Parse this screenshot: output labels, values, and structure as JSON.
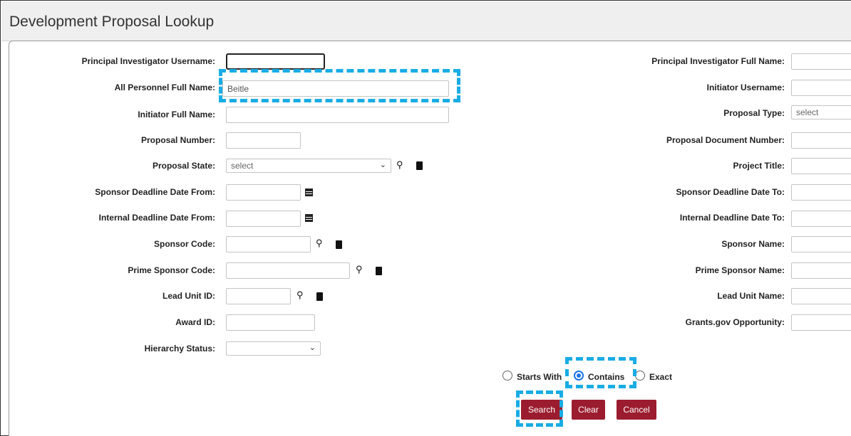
{
  "page": {
    "title": "Development Proposal Lookup"
  },
  "left_fields": {
    "pi_username": {
      "label": "Principal Investigator Username:",
      "value": ""
    },
    "all_personnel": {
      "label": "All Personnel Full Name:",
      "value": "Beitle"
    },
    "initiator_full_name": {
      "label": "Initiator Full Name:",
      "value": ""
    },
    "proposal_number": {
      "label": "Proposal Number:",
      "value": ""
    },
    "proposal_state": {
      "label": "Proposal State:",
      "value": "select"
    },
    "sponsor_deadline_from": {
      "label": "Sponsor Deadline Date From:",
      "value": ""
    },
    "internal_deadline_from": {
      "label": "Internal Deadline Date From:",
      "value": ""
    },
    "sponsor_code": {
      "label": "Sponsor Code:",
      "value": ""
    },
    "prime_sponsor_code": {
      "label": "Prime Sponsor Code:",
      "value": ""
    },
    "lead_unit_id": {
      "label": "Lead Unit ID:",
      "value": ""
    },
    "award_id": {
      "label": "Award ID:",
      "value": ""
    },
    "hierarchy_status": {
      "label": "Hierarchy Status:",
      "value": ""
    }
  },
  "right_fields": {
    "pi_full_name": {
      "label": "Principal Investigator Full Name:",
      "value": ""
    },
    "initiator_username": {
      "label": "Initiator Username:",
      "value": ""
    },
    "proposal_type": {
      "label": "Proposal Type:",
      "value": "select"
    },
    "proposal_document_number": {
      "label": "Proposal Document Number:",
      "value": ""
    },
    "project_title": {
      "label": "Project Title:",
      "value": ""
    },
    "sponsor_deadline_to": {
      "label": "Sponsor Deadline Date To:",
      "value": ""
    },
    "internal_deadline_to": {
      "label": "Internal Deadline Date To:",
      "value": ""
    },
    "sponsor_name": {
      "label": "Sponsor Name:",
      "value": ""
    },
    "prime_sponsor_name": {
      "label": "Prime Sponsor Name:",
      "value": ""
    },
    "lead_unit_name": {
      "label": "Lead Unit Name:",
      "value": ""
    },
    "grants_gov_opportunity": {
      "label": "Grants.gov Opportunity:",
      "value": ""
    }
  },
  "match_options": {
    "starts_with": "Starts With",
    "contains": "Contains",
    "exact": "Exact",
    "selected": "Contains"
  },
  "buttons": {
    "search": "Search",
    "clear": "Clear",
    "cancel": "Cancel"
  },
  "icons": {
    "lookup": "search-icon",
    "direct_inquiry": "book-icon",
    "date_picker": "calendar-icon",
    "dropdown": "chevron-down-icon"
  },
  "colors": {
    "button_bg": "#9b1c2e",
    "highlight": "#19ace5",
    "radio_selected": "#1a73e8",
    "header_bg": "#efefef"
  }
}
